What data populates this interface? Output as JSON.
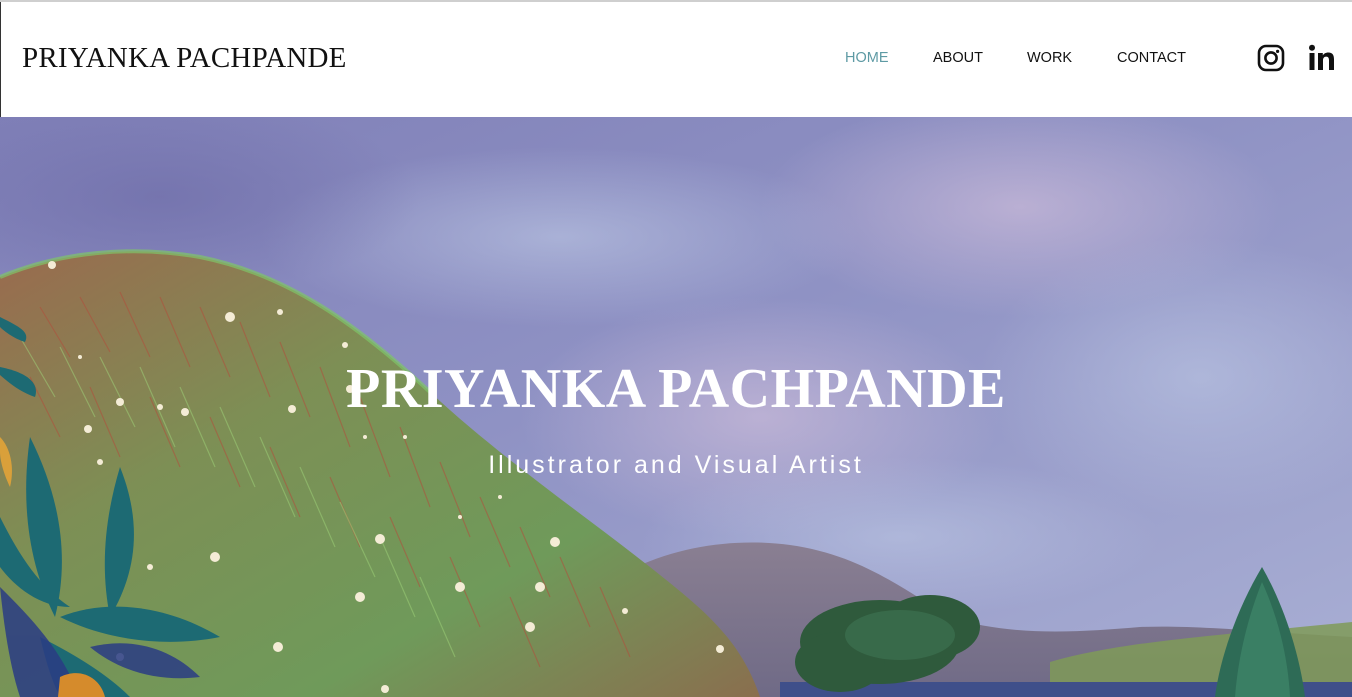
{
  "header": {
    "brand": "PRIYANKA PACHPANDE",
    "nav": [
      {
        "label": "HOME",
        "active": true
      },
      {
        "label": "ABOUT",
        "active": false
      },
      {
        "label": "WORK",
        "active": false
      },
      {
        "label": "CONTACT",
        "active": false
      }
    ],
    "social": [
      {
        "icon": "instagram-icon"
      },
      {
        "icon": "linkedin-icon"
      }
    ]
  },
  "hero": {
    "title": "PRIYANKA PACHPANDE",
    "subtitle": "Illustrator and Visual Artist"
  },
  "colors": {
    "accent": "#5e9aa4",
    "text": "#111111",
    "sky": "#8f92c4",
    "hill": "#7d8f55"
  }
}
